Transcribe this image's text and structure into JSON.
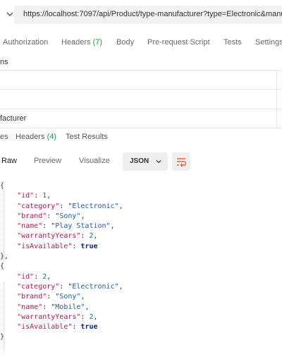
{
  "url_bar": {
    "url": "https://localhost:7097/api/Product/type-manufacturer?type=Electronic&manu"
  },
  "request_tabs": [
    {
      "label": "Authorization",
      "count": ""
    },
    {
      "label": "Headers",
      "count": "(7)"
    },
    {
      "label": "Body",
      "count": ""
    },
    {
      "label": "Pre-request Script",
      "count": ""
    },
    {
      "label": "Tests",
      "count": ""
    },
    {
      "label": "Settings",
      "count": ""
    }
  ],
  "params": {
    "section_label": "ns",
    "rows": [
      "",
      "",
      "facturer"
    ]
  },
  "response_tabs": [
    {
      "label": "es",
      "count": ""
    },
    {
      "label": "Headers",
      "count": "(4)"
    },
    {
      "label": "Test Results",
      "count": ""
    }
  ],
  "view_tabs": [
    "Raw",
    "Preview",
    "Visualize"
  ],
  "format_select": {
    "selected": "JSON"
  },
  "response_body": [
    {
      "id": 1,
      "category": "Electronic",
      "brand": "Sony",
      "name": "Play Station",
      "warrantyYears": 2,
      "isAvailable": true
    },
    {
      "id": 2,
      "category": "Electronic",
      "brand": "Sony",
      "name": "Mobile",
      "warrantyYears": 2,
      "isAvailable": true
    }
  ],
  "colors": {
    "key": "#b9164a",
    "string": "#195bb4",
    "number": "#13844a",
    "boolean": "#0d2a7a",
    "count_green": "#1f9e4d",
    "wrap_icon": "#e8613c"
  },
  "icons": {
    "url_chevron": "chevron-down-icon",
    "format_chevron": "chevron-down-icon",
    "wrap": "wrap-lines-icon"
  }
}
